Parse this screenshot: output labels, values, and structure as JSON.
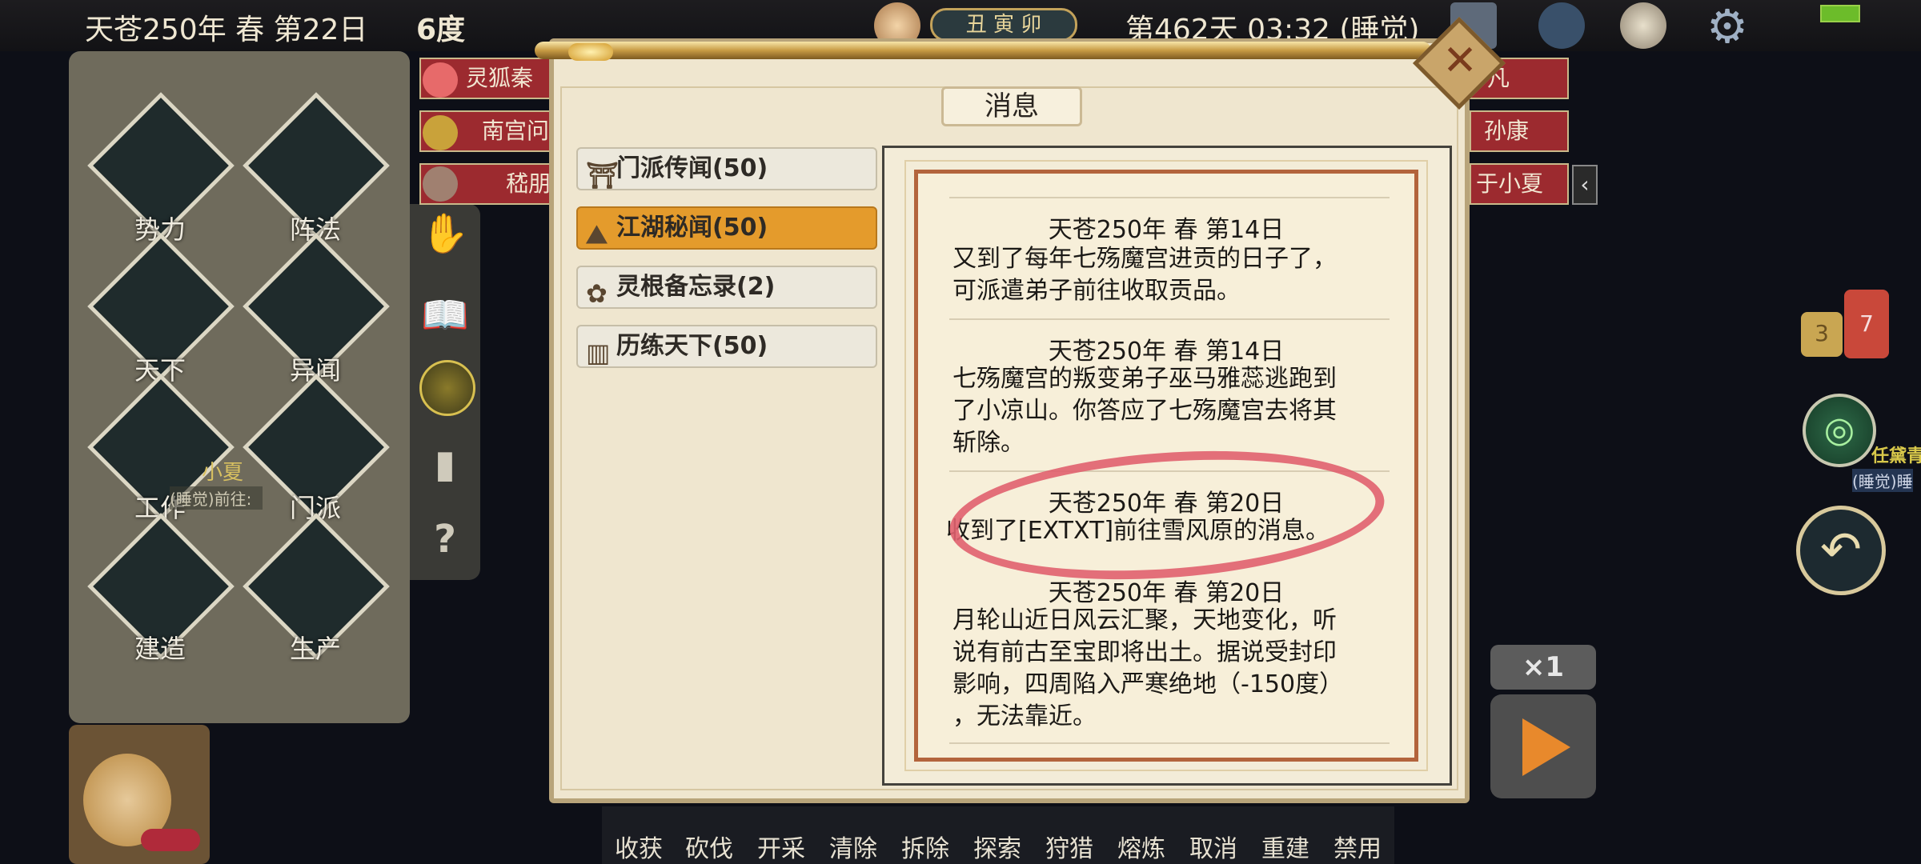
{
  "topbar": {
    "date": "天苍250年 春 第22日",
    "temperature": "6度",
    "time_chars": "丑 寅 卯",
    "day_time": "第462天 03:32 (睡觉)"
  },
  "left_menu": {
    "items": [
      {
        "label": "势力",
        "icon": "faction-icon"
      },
      {
        "label": "阵法",
        "icon": "formation-icon"
      },
      {
        "label": "天下",
        "icon": "world-icon"
      },
      {
        "label": "异闻",
        "icon": "rumor-icon"
      },
      {
        "label": "工作",
        "icon": "work-icon"
      },
      {
        "label": "门派",
        "icon": "sect-icon"
      },
      {
        "label": "建造",
        "icon": "build-icon"
      },
      {
        "label": "生产",
        "icon": "produce-icon"
      }
    ],
    "overlay_name": "小夏",
    "overlay_status": "(睡觉)前往:"
  },
  "chips": {
    "left": [
      "灵狐秦",
      "南宫问",
      "嵇朋"
    ],
    "right": [
      "凡",
      "孙康",
      "于小夏"
    ]
  },
  "dialog": {
    "title": "消息",
    "tabs": [
      {
        "label": "门派传闻(50)",
        "active": false
      },
      {
        "label": "江湖秘闻(50)",
        "active": true
      },
      {
        "label": "灵根备忘录(2)",
        "active": false
      },
      {
        "label": "历练天下(50)",
        "active": false
      }
    ],
    "entries": [
      {
        "date": "天苍250年 春 第14日",
        "lines": [
          "又到了每年七殇魔宫进贡的日子了，",
          "可派遣弟子前往收取贡品。"
        ]
      },
      {
        "date": "天苍250年 春 第14日",
        "lines": [
          "七殇魔宫的叛变弟子巫马雅蕊逃跑到",
          "了小凉山。你答应了七殇魔宫去将其",
          "斩除。"
        ]
      },
      {
        "date": "天苍250年 春 第20日",
        "lines": [
          "收到了[EXTXT]前往雪风原的消息。"
        ]
      },
      {
        "date": "天苍250年 春 第20日",
        "lines": [
          "月轮山近日风云汇聚，天地变化，听",
          "说有前古至宝即将出土。据说受封印",
          "影响，四周陷入严寒绝地（-150度）",
          "，无法靠近。"
        ]
      }
    ]
  },
  "toolbar": {
    "tools": [
      "收获",
      "砍伐",
      "开采",
      "清除",
      "拆除",
      "探索",
      "狩猎",
      "熔炼",
      "取消",
      "重建",
      "禁用"
    ]
  },
  "right": {
    "bubble_yellow": "3",
    "bubble_red": "7",
    "avatar_name": "任黛青",
    "avatar_status": "(睡觉)睡",
    "speed": "×1"
  },
  "colors": {
    "active_tab": "#e49b2c",
    "chip_red": "#9c2a2f",
    "annotation_circle": "#e0606e"
  }
}
